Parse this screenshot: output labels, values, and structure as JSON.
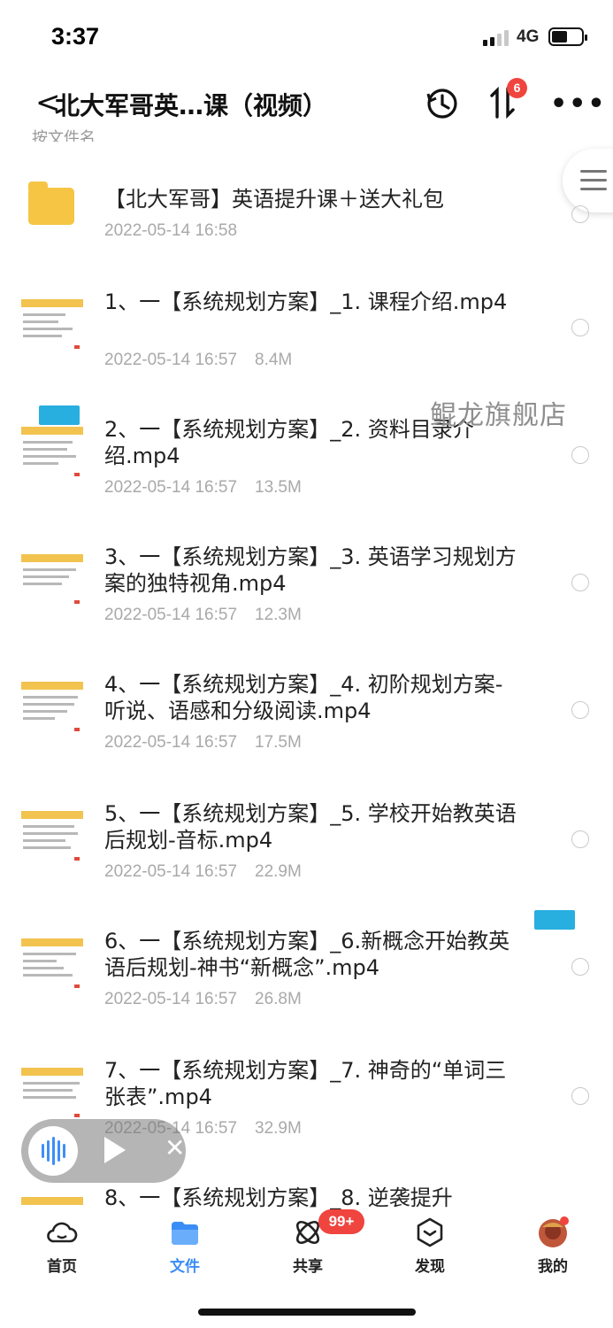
{
  "status_bar": {
    "time": "3:37",
    "network": "4G"
  },
  "header": {
    "back_symbol": "<",
    "title": "北大军哥英…课（视频）",
    "transfer_badge": "6"
  },
  "sort_bar": {
    "partial_text": "按文件名"
  },
  "files": [
    {
      "type": "folder",
      "name": "【北大军哥】英语提升课＋送大礼包",
      "date": "2022-05-14 16:58",
      "size": ""
    },
    {
      "type": "video",
      "name": "1、一【系统规划方案】_1. 课程介绍.mp4",
      "date": "2022-05-14 16:57",
      "size": "8.4M"
    },
    {
      "type": "video",
      "name": "2、一【系统规划方案】_2. 资料目录介绍.mp4",
      "date": "2022-05-14 16:57",
      "size": "13.5M"
    },
    {
      "type": "video",
      "name": "3、一【系统规划方案】_3. 英语学习规划方案的独特视角.mp4",
      "date": "2022-05-14 16:57",
      "size": "12.3M"
    },
    {
      "type": "video",
      "name": "4、一【系统规划方案】_4. 初阶规划方案-听说、语感和分级阅读.mp4",
      "date": "2022-05-14 16:57",
      "size": "17.5M"
    },
    {
      "type": "video",
      "name": "5、一【系统规划方案】_5. 学校开始教英语后规划-音标.mp4",
      "date": "2022-05-14 16:57",
      "size": "22.9M"
    },
    {
      "type": "video",
      "name": "6、一【系统规划方案】_6.新概念开始教英语后规划-神书“新概念”.mp4",
      "date": "2022-05-14 16:57",
      "size": "26.8M"
    },
    {
      "type": "video",
      "name": "7、一【系统规划方案】_7. 神奇的“单词三张表”.mp4",
      "date": "2022-05-14 16:57",
      "size": "32.9M"
    },
    {
      "type": "video",
      "name": "8、一【系统规划方案】_8. 逆袭提升",
      "date": "",
      "size": ""
    }
  ],
  "watermark": {
    "text": "鲲龙旗舰店",
    "logo_text": "鲲龙旗舰店"
  },
  "tabs": [
    {
      "label": "首页",
      "icon": "cloud-icon",
      "active": false
    },
    {
      "label": "文件",
      "icon": "folder-icon",
      "active": true
    },
    {
      "label": "共享",
      "icon": "share-icon",
      "active": false,
      "badge": "99+"
    },
    {
      "label": "发现",
      "icon": "discover-icon",
      "active": false
    },
    {
      "label": "我的",
      "icon": "avatar-icon",
      "active": false
    }
  ],
  "colors": {
    "accent": "#3b8df6",
    "badge": "#f0443e",
    "folder": "#f6c544",
    "meta": "#a9a9a9"
  }
}
